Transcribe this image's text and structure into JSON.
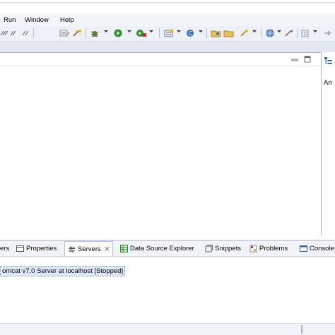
{
  "menu": {
    "items": [
      "Run",
      "Window",
      "Help"
    ]
  },
  "toolbar": {
    "icons": [
      "collapse-icon",
      "task-icon",
      "debug-icon",
      "run-icon",
      "external-tools-icon",
      "new-server-icon",
      "new-class-icon",
      "open-type-icon",
      "open-task-icon",
      "search-icon",
      "globe-icon",
      "perspective-icon",
      "back-icon"
    ]
  },
  "outline": {
    "label": "An"
  },
  "bottom_tabs": {
    "tab0": "ers",
    "tab1": "Properties",
    "tab2": "Servers",
    "tab2_close": "✕",
    "tab3": "Data Source Explorer",
    "tab4": "Snippets",
    "tab5": "Problems",
    "tab6": "Console"
  },
  "servers": {
    "row": "omcat v7.0 Server at localhost  [Stopped]"
  },
  "colors": {
    "accent": "#3a6fb8",
    "run_green": "#2e8b2e",
    "selection": "#dde7f5"
  }
}
